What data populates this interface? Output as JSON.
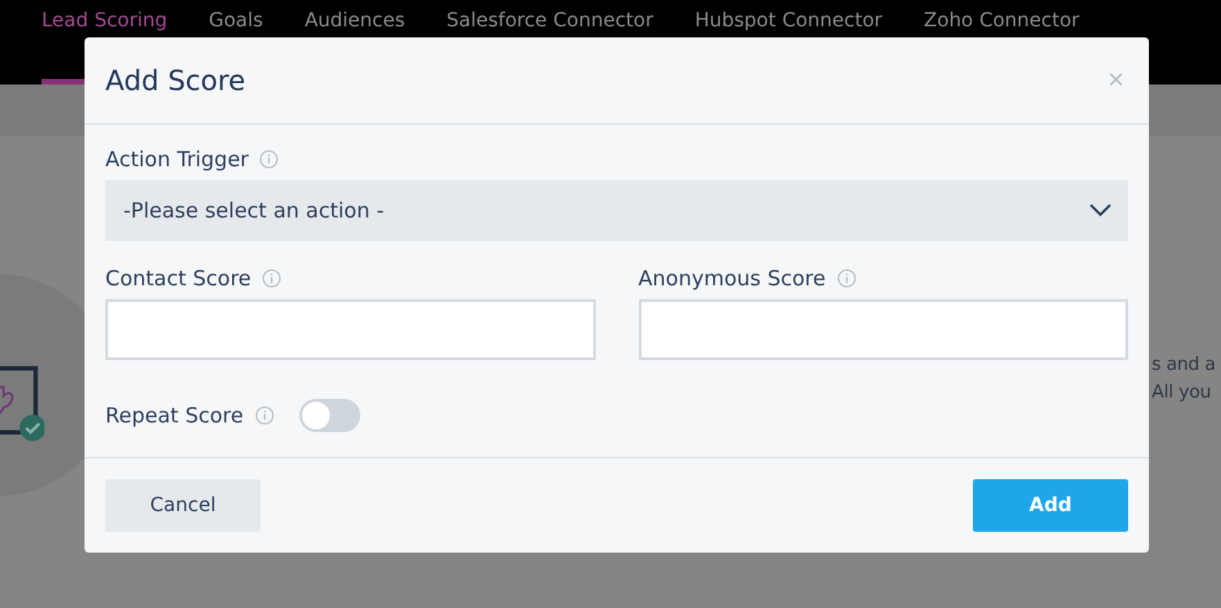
{
  "nav_tabs": [
    {
      "label": "Lead Scoring",
      "selected": true
    },
    {
      "label": "Goals",
      "selected": false
    },
    {
      "label": "Audiences",
      "selected": false
    },
    {
      "label": "Salesforce Connector",
      "selected": false
    },
    {
      "label": "Hubspot Connector",
      "selected": false
    },
    {
      "label": "Zoho Connector",
      "selected": false
    }
  ],
  "background_text": [
    "s and a",
    "All you"
  ],
  "dialog": {
    "title": "Add Score",
    "close": "×",
    "action_trigger": {
      "label": "Action Trigger",
      "value": "-Please select an action -"
    },
    "fields": [
      {
        "label": "Contact Score"
      },
      {
        "label": "Anonymous Score"
      }
    ],
    "repeat_score": {
      "label": "Repeat Score",
      "on": false
    },
    "buttons": [
      {
        "label": "Cancel",
        "kind": "secondary"
      },
      {
        "label": "Add",
        "kind": "primary"
      }
    ]
  }
}
